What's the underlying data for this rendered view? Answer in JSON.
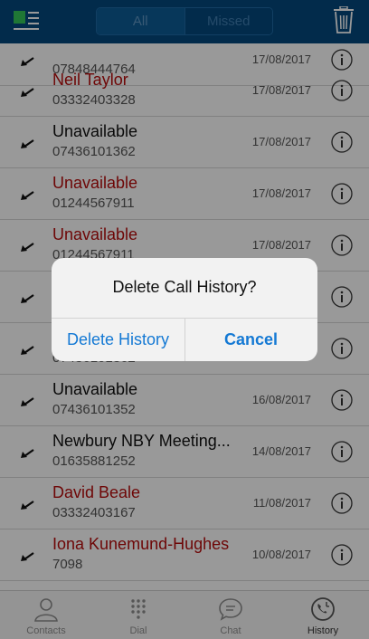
{
  "header": {
    "tabs": [
      {
        "label": "All"
      },
      {
        "label": "Missed"
      }
    ],
    "menu_icon": "list-menu-icon",
    "trash_icon": "trash-icon",
    "accent_color": "#04497e"
  },
  "calls": [
    {
      "name": "",
      "number": "07848444764",
      "date": "17/08/2017",
      "missed": false
    },
    {
      "name": "Neil Taylor",
      "number": "03332403328",
      "date": "17/08/2017",
      "missed": true
    },
    {
      "name": "Unavailable",
      "number": "07436101362",
      "date": "17/08/2017",
      "missed": false
    },
    {
      "name": "Unavailable",
      "number": "01244567911",
      "date": "17/08/2017",
      "missed": true
    },
    {
      "name": "Unavailable",
      "number": "01244567911",
      "date": "17/08/2017",
      "missed": true
    },
    {
      "name": "",
      "number": "",
      "date": "",
      "missed": false
    },
    {
      "name": "",
      "number": "07436101362",
      "date": "",
      "missed": false
    },
    {
      "name": "Unavailable",
      "number": "07436101352",
      "date": "16/08/2017",
      "missed": false
    },
    {
      "name": "Newbury NBY Meeting...",
      "number": "01635881252",
      "date": "14/08/2017",
      "missed": false
    },
    {
      "name": "David Beale",
      "number": "03332403167",
      "date": "11/08/2017",
      "missed": true
    },
    {
      "name": "Iona Kunemund-Hughes",
      "number": "7098",
      "date": "10/08/2017",
      "missed": true
    }
  ],
  "tabbar": [
    {
      "label": "Contacts",
      "icon": "person-icon"
    },
    {
      "label": "Dial",
      "icon": "keypad-icon"
    },
    {
      "label": "Chat",
      "icon": "chat-bubble-icon"
    },
    {
      "label": "History",
      "icon": "clock-phone-icon"
    }
  ],
  "dialog": {
    "title": "Delete Call History?",
    "confirm_label": "Delete History",
    "cancel_label": "Cancel",
    "button_color": "#1479d4"
  },
  "colors": {
    "missed": "#b80d0d",
    "normal": "#111111"
  }
}
